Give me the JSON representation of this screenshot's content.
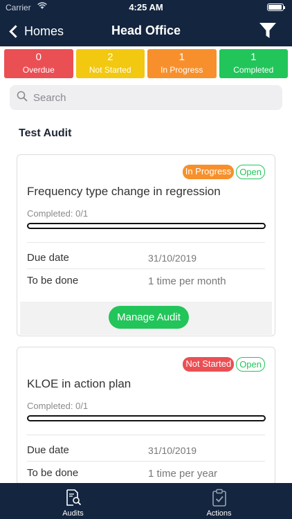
{
  "status_bar": {
    "carrier": "Carrier",
    "time": "4:25 AM"
  },
  "nav": {
    "back_label": "Homes",
    "title": "Head Office"
  },
  "stats": [
    {
      "count": "0",
      "label": "Overdue",
      "color": "#ea4f54"
    },
    {
      "count": "2",
      "label": "Not Started",
      "color": "#f2c811"
    },
    {
      "count": "1",
      "label": "In Progress",
      "color": "#f7902c"
    },
    {
      "count": "1",
      "label": "Completed",
      "color": "#22c55a"
    }
  ],
  "search": {
    "placeholder": "Search"
  },
  "section_title": "Test Audit",
  "cards": [
    {
      "status_badge": "In Progress",
      "state_badge": "Open",
      "title": "Frequency type change in regression",
      "completed": "Completed: 0/1",
      "progress": 0,
      "due_label": "Due date",
      "due_value": "31/10/2019",
      "todo_label": "To be done",
      "todo_value": "1 time per month",
      "action_label": "Manage Audit"
    },
    {
      "status_badge": "Not Started",
      "state_badge": "Open",
      "title": "KLOE in action plan",
      "completed": "Completed: 0/1",
      "progress": 0,
      "due_label": "Due date",
      "due_value": "31/10/2019",
      "todo_label": "To be done",
      "todo_value": "1 time per year"
    }
  ],
  "tabbar": {
    "tabs": [
      {
        "label": "Audits",
        "icon": "audit-search-icon"
      },
      {
        "label": "Actions",
        "icon": "clipboard-check-icon"
      }
    ]
  }
}
